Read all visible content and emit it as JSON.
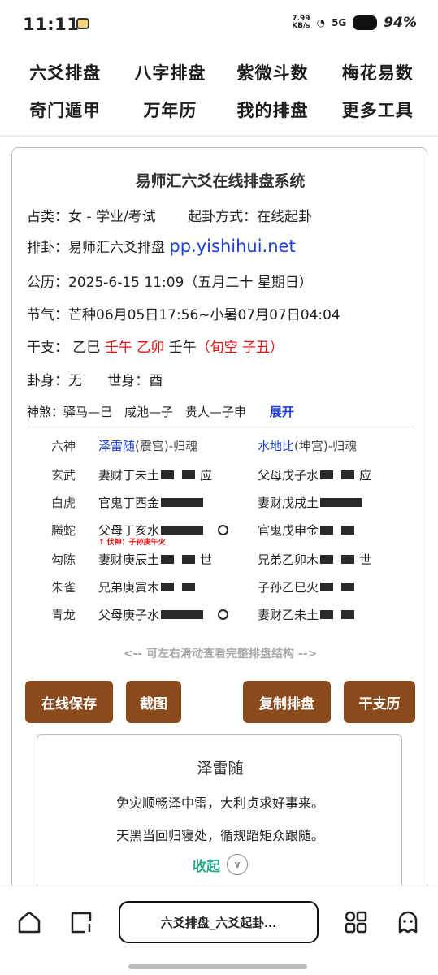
{
  "status": {
    "time": "11:11",
    "speed_top": "7.99",
    "speed_bottom": "KB/s",
    "net": "5G",
    "battery": "94%"
  },
  "topnav": [
    "六爻排盘",
    "八字排盘",
    "紫微斗数",
    "梅花易数",
    "奇门遁甲",
    "万年历",
    "我的排盘",
    "更多工具"
  ],
  "card": {
    "title": "易师汇六爻在线排盘系统",
    "zhanlei": "占类：女 - 学业/考试",
    "qigua": "起卦方式：在线起卦",
    "paigua_label": "排卦：易师汇六爻排盘",
    "site": "pp.yishihui.net",
    "gongli": "公历：2025-6-15 11:09（五月二十 星期日）",
    "jieqi": "节气：芒种06月05日17:56~小暑07月07日04:04",
    "ganzhi_label": "干支：",
    "gz1": "乙巳",
    "gz2": "壬午",
    "gz3": "乙卯",
    "gz4": "壬午",
    "xunkong": "（旬空 子丑）",
    "guashen": "卦身：无",
    "shishen": "世身：酉",
    "shensha": "神煞：驿马—巳　咸池—子　贵人—子申",
    "expand": "展开"
  },
  "hex": {
    "head": {
      "god": "六神",
      "left_name": "泽雷随",
      "left_rest": "(震宫)-归魂",
      "right_name": "水地比",
      "right_rest": "(坤宫)-归魂"
    },
    "rows": [
      {
        "god": "玄武",
        "left": "妻财丁未土",
        "ltype": "yin",
        "lmark": "应",
        "right": "父母戊子水",
        "rtype": "yin",
        "rmark": "应"
      },
      {
        "god": "白虎",
        "left": "官鬼丁酉金",
        "ltype": "yang",
        "lmark": "",
        "right": "妻财戊戌土",
        "rtype": "yang",
        "rmark": ""
      },
      {
        "god": "螣蛇",
        "left": "父母丁亥水",
        "ltype": "yang",
        "lmark": "O",
        "right": "官鬼戊申金",
        "rtype": "yin",
        "rmark": ""
      },
      {
        "god": "勾陈",
        "left": "妻财庚辰土",
        "ltype": "yin",
        "lmark": "世",
        "right": "兄弟乙卯木",
        "rtype": "yin",
        "rmark": "世"
      },
      {
        "god": "朱雀",
        "left": "兄弟庚寅木",
        "ltype": "yin",
        "lmark": "",
        "right": "子孙乙巳火",
        "rtype": "yin",
        "rmark": ""
      },
      {
        "god": "青龙",
        "left": "父母庚子水",
        "ltype": "yang",
        "lmark": "O",
        "right": "妻财乙未土",
        "rtype": "yin",
        "rmark": ""
      }
    ],
    "fushen": "↑ 伏神：子孙庚午火"
  },
  "hint": "<-- 可左右滑动查看完整排盘结构 -->",
  "buttons": {
    "save": "在线保存",
    "screenshot": "截图",
    "copy": "复制排盘",
    "ganzhi": "干支历"
  },
  "explain": {
    "title": "泽雷随",
    "line1": "免灾顺畅泽中雷，大利贞求好事来。",
    "line2": "天黑当回归寝处，循规蹈矩众跟随。",
    "collapse": "收起"
  },
  "bottom": {
    "tab_title": "六爻排盘_六爻起卦…"
  }
}
